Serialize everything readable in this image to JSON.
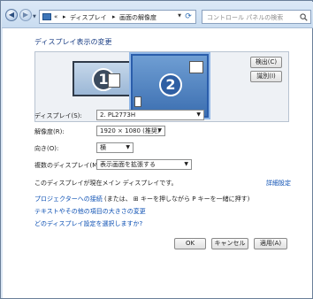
{
  "address": {
    "prefix": "«",
    "crumbs": [
      "ディスプレイ",
      "画面の解像度"
    ],
    "separator": "▸"
  },
  "search": {
    "placeholder": "コントロール パネルの検索"
  },
  "main": {
    "title": "ディスプレイ表示の変更",
    "detect_label": "検出(C)",
    "identify_label": "識別(I)",
    "monitor1_number": "1",
    "monitor2_number": "2"
  },
  "fields": {
    "display": {
      "label": "ディスプレイ(S):",
      "value": "2. PL2773H"
    },
    "resolution": {
      "label": "解像度(R):",
      "value": "1920 × 1080 (推奨)"
    },
    "orientation": {
      "label": "向き(O):",
      "value": "横"
    },
    "multiple": {
      "label": "複数のディスプレイ(M):",
      "value": "表示画面を拡張する"
    }
  },
  "status": {
    "main_display_text": "このディスプレイが現在メイン ディスプレイです。",
    "advanced_label": "詳細設定"
  },
  "links": {
    "projector_link": "プロジェクターへの接続",
    "projector_hint": "(または、 ⊞ キーを押しながら P キーを一緒に押す)",
    "text_size_link": "テキストやその他の項目の大きさの変更",
    "which_settings_link": "どのディスプレイ設定を選択しますか?"
  },
  "footer": {
    "ok_label": "OK",
    "cancel_label": "キャンセル",
    "apply_label": "適用(A)"
  },
  "colors": {
    "link": "#0b4fb3",
    "title": "#1b3f85",
    "selected_monitor": "#3c6fb1"
  }
}
